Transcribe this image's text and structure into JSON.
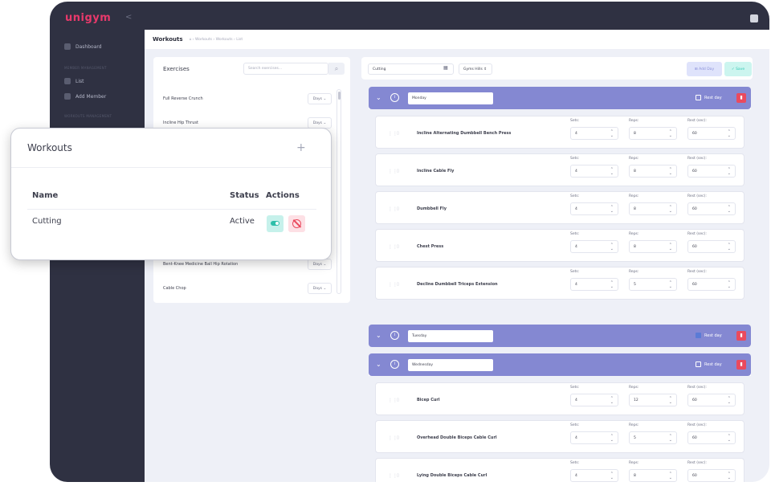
{
  "sidebar": {
    "brand": "unigym",
    "collapse_icon": "chevron-left-icon",
    "items": [
      {
        "label": "Dashboard",
        "icon": "dashboard-icon"
      },
      {
        "label": "List",
        "icon": "users-icon"
      },
      {
        "label": "Add Member",
        "icon": "add-user-icon"
      }
    ],
    "section1": "MEMBER MANAGEMENT",
    "section2": "WORKOUTS MANAGEMENT"
  },
  "breadcrumb": {
    "title": "Workouts",
    "path": "⌂ › Workouts › Workouts › List"
  },
  "exercises": {
    "title": "Exercises",
    "search_placeholder": "Search exercises...",
    "days_label": "Days ⌄",
    "items": [
      "Full Reverse Crunch",
      "Incline Hip Thrust",
      "Bent-Knee Medicine Ball Hip Rotation",
      "Cable Chop"
    ]
  },
  "plan": {
    "name": "Cutting",
    "gym": "Gyms Hills ⇕",
    "add_day": "⊞ Add Day",
    "save": "✓ Save",
    "rest_label": "Rest day",
    "labels": {
      "sets": "Sets:",
      "reps": "Reps:",
      "rest": "Rest (sec):"
    },
    "days": [
      {
        "name": "Monday",
        "exercises": [
          {
            "name": "Incline Alternating Dumbbell Bench Press",
            "sets": "4",
            "reps": "8",
            "rest": "60"
          },
          {
            "name": "Incline Cable Fly",
            "sets": "4",
            "reps": "8",
            "rest": "60"
          },
          {
            "name": "Dumbbell Fly",
            "sets": "4",
            "reps": "8",
            "rest": "60"
          },
          {
            "name": "Chest Press",
            "sets": "4",
            "reps": "8",
            "rest": "60"
          },
          {
            "name": "Decline Dumbbell Triceps Extension",
            "sets": "4",
            "reps": "5",
            "rest": "60"
          }
        ]
      },
      {
        "name": "Tuesday",
        "exercises": []
      },
      {
        "name": "Wednesday",
        "exercises": [
          {
            "name": "Bicep Curl",
            "sets": "4",
            "reps": "12",
            "rest": "60"
          },
          {
            "name": "Overhead Double Biceps Cable Curl",
            "sets": "4",
            "reps": "5",
            "rest": "60"
          },
          {
            "name": "Lying Double Biceps Cable Curl",
            "sets": "4",
            "reps": "8",
            "rest": "60"
          }
        ]
      }
    ]
  },
  "popup": {
    "title": "Workouts",
    "plus": "+",
    "headers": {
      "name": "Name",
      "status": "Status",
      "actions": "Actions"
    },
    "row": {
      "name": "Cutting",
      "status": "Active"
    }
  },
  "colors": {
    "sidebar": "#2f3142",
    "brand": "#e8396b",
    "day_header": "#8488d2",
    "delete": "#ea4a5e",
    "accent_teal": "#32c9b3"
  }
}
